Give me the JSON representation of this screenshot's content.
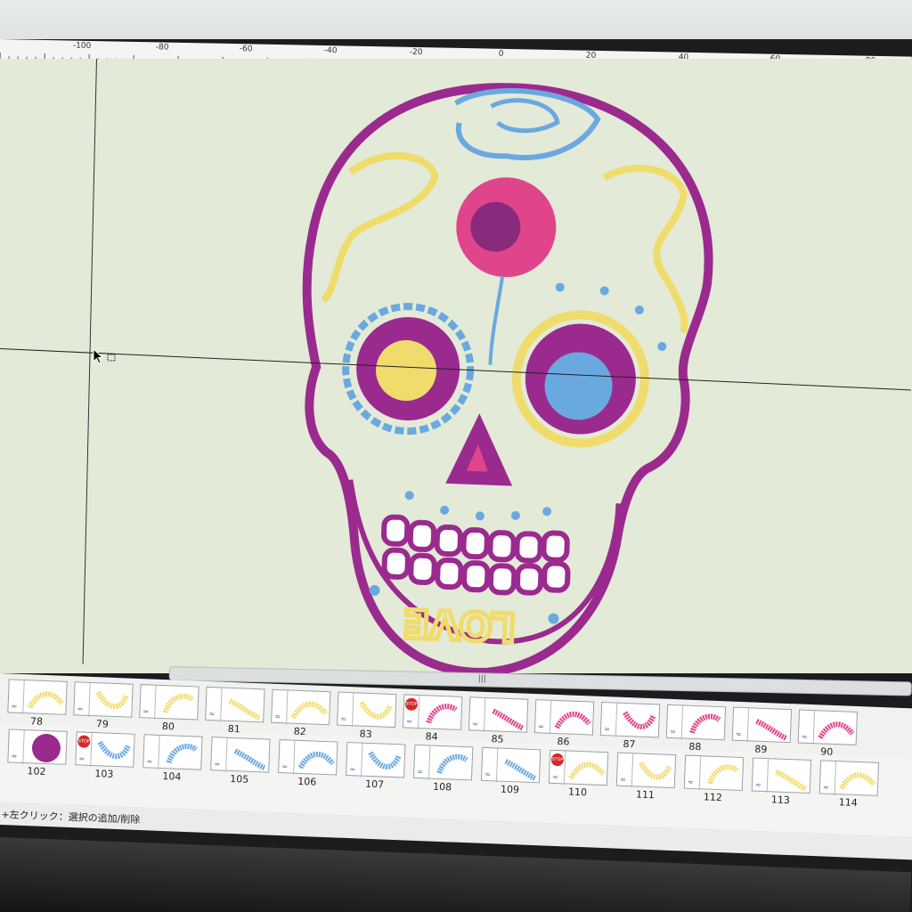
{
  "ruler": {
    "labels": [
      "0",
      "-100",
      "-80",
      "-60",
      "-40",
      "-20",
      "0",
      "20",
      "40",
      "60",
      "80"
    ]
  },
  "canvas": {
    "background": "#e3ead7",
    "design": {
      "text": "LOVE",
      "colors": {
        "outline": "#9b2a8f",
        "pink": "#e0458c",
        "blue": "#6aa8e0",
        "yellow": "#f0dc6c"
      }
    }
  },
  "scrollbar": {
    "grip": "|||"
  },
  "thumbnails_row1": [
    {
      "num": "78",
      "color": "#f0dc6c"
    },
    {
      "num": "79",
      "color": "#f0dc6c"
    },
    {
      "num": "80",
      "color": "#f0dc6c"
    },
    {
      "num": "81",
      "color": "#f0dc6c"
    },
    {
      "num": "82",
      "color": "#f0dc6c"
    },
    {
      "num": "83",
      "color": "#f0dc6c"
    },
    {
      "num": "84",
      "color": "#e0458c",
      "stop": true
    },
    {
      "num": "85",
      "color": "#e0458c"
    },
    {
      "num": "86",
      "color": "#e0458c"
    },
    {
      "num": "87",
      "color": "#e0458c"
    },
    {
      "num": "88",
      "color": "#e0458c"
    },
    {
      "num": "89",
      "color": "#e0458c"
    },
    {
      "num": "90",
      "color": "#e0458c"
    }
  ],
  "thumbnails_row2": [
    {
      "num": "102",
      "color": "#9b2a8f"
    },
    {
      "num": "103",
      "color": "#6aa8e0",
      "stop": true
    },
    {
      "num": "104",
      "color": "#6aa8e0"
    },
    {
      "num": "105",
      "color": "#6aa8e0"
    },
    {
      "num": "106",
      "color": "#6aa8e0"
    },
    {
      "num": "107",
      "color": "#6aa8e0"
    },
    {
      "num": "108",
      "color": "#6aa8e0"
    },
    {
      "num": "109",
      "color": "#6aa8e0"
    },
    {
      "num": "110",
      "color": "#f0dc6c",
      "stop": true
    },
    {
      "num": "111",
      "color": "#f0dc6c"
    },
    {
      "num": "112",
      "color": "#f0dc6c"
    },
    {
      "num": "113",
      "color": "#f0dc6c"
    },
    {
      "num": "114",
      "color": "#f0dc6c"
    }
  ],
  "stop_label": "STOP",
  "status": {
    "text": "+左クリック：選択の追加/削除"
  }
}
